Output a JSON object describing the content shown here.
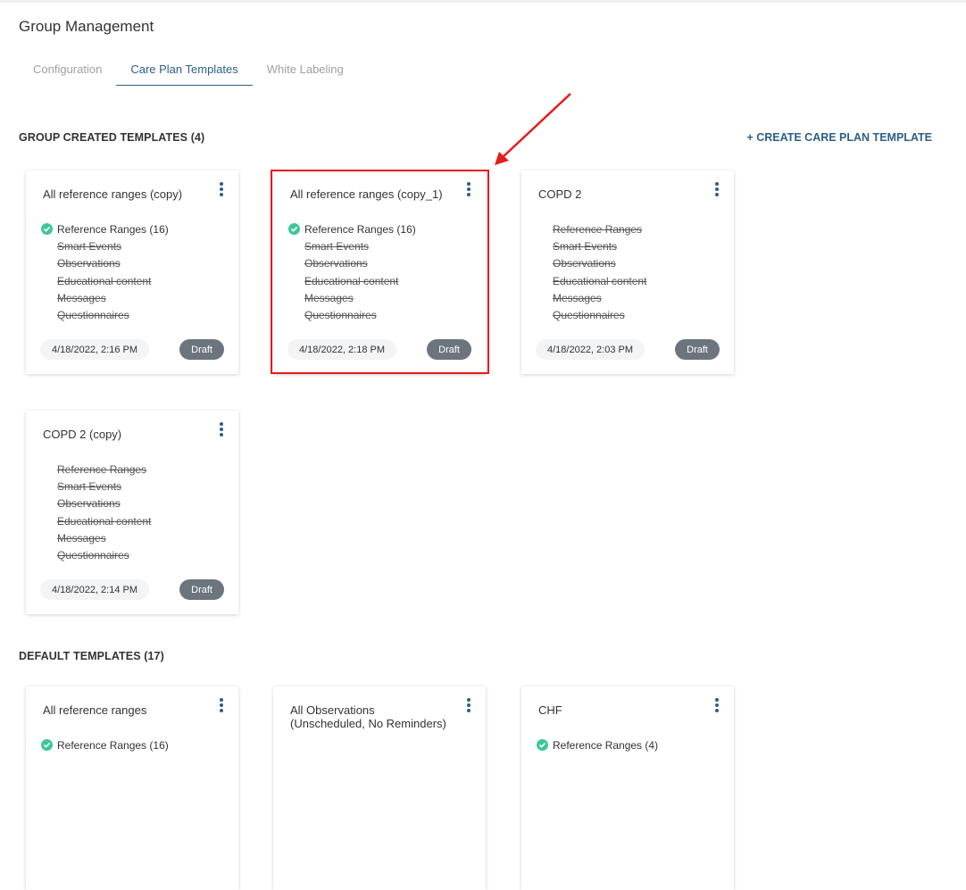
{
  "page": {
    "title": "Group Management"
  },
  "tabs": [
    {
      "label": "Configuration"
    },
    {
      "label": "Care Plan Templates"
    },
    {
      "label": "White Labeling"
    }
  ],
  "group_section": {
    "heading": "GROUP CREATED TEMPLATES (4)",
    "create_label": "+ CREATE CARE PLAN TEMPLATE"
  },
  "default_section": {
    "heading": "DEFAULT TEMPLATES (17)"
  },
  "group_templates": [
    {
      "title": "All reference ranges (copy)",
      "items": [
        {
          "label": "Reference Ranges (16)",
          "enabled": true
        },
        {
          "label": "Smart Events",
          "enabled": false
        },
        {
          "label": "Observations",
          "enabled": false
        },
        {
          "label": "Educational content",
          "enabled": false
        },
        {
          "label": "Messages",
          "enabled": false
        },
        {
          "label": "Questionnaires",
          "enabled": false
        }
      ],
      "date": "4/18/2022, 2:16 PM",
      "status": "Draft"
    },
    {
      "title": "All reference ranges (copy_1)",
      "items": [
        {
          "label": "Reference Ranges (16)",
          "enabled": true
        },
        {
          "label": "Smart Events",
          "enabled": false
        },
        {
          "label": "Observations",
          "enabled": false
        },
        {
          "label": "Educational content",
          "enabled": false
        },
        {
          "label": "Messages",
          "enabled": false
        },
        {
          "label": "Questionnaires",
          "enabled": false
        }
      ],
      "date": "4/18/2022, 2:18 PM",
      "status": "Draft"
    },
    {
      "title": "COPD 2",
      "items": [
        {
          "label": "Reference Ranges",
          "enabled": false
        },
        {
          "label": "Smart Events",
          "enabled": false
        },
        {
          "label": "Observations",
          "enabled": false
        },
        {
          "label": "Educational content",
          "enabled": false
        },
        {
          "label": "Messages",
          "enabled": false
        },
        {
          "label": "Questionnaires",
          "enabled": false
        }
      ],
      "date": "4/18/2022, 2:03 PM",
      "status": "Draft"
    },
    {
      "title": "COPD 2 (copy)",
      "items": [
        {
          "label": "Reference Ranges",
          "enabled": false
        },
        {
          "label": "Smart Events",
          "enabled": false
        },
        {
          "label": "Observations",
          "enabled": false
        },
        {
          "label": "Educational content",
          "enabled": false
        },
        {
          "label": "Messages",
          "enabled": false
        },
        {
          "label": "Questionnaires",
          "enabled": false
        }
      ],
      "date": "4/18/2022, 2:14 PM",
      "status": "Draft"
    }
  ],
  "default_templates": [
    {
      "title": "All reference ranges",
      "items": [
        {
          "label": "Reference Ranges (16)",
          "enabled": true
        }
      ]
    },
    {
      "title": "All Observations (Unscheduled, No Reminders)",
      "items": []
    },
    {
      "title": "CHF",
      "items": [
        {
          "label": "Reference Ranges (4)",
          "enabled": true
        }
      ]
    }
  ],
  "colors": {
    "accent": "#2d5f87",
    "check": "#3fc79a",
    "draft_badge": "#6c757d",
    "annotation": "#e31c1c"
  },
  "icons": {
    "kebab": "vertical-ellipsis-icon",
    "check": "check-circle-icon"
  }
}
